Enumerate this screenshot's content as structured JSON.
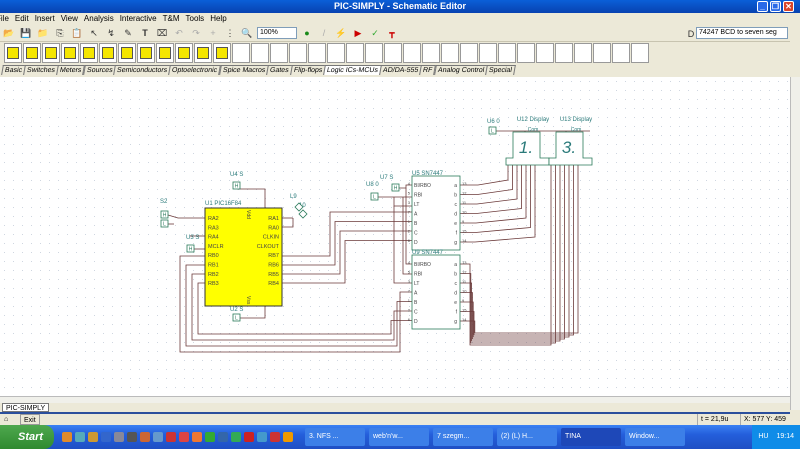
{
  "window": {
    "title": "PIC-SIMPLY - Schematic Editor"
  },
  "menu": [
    "File",
    "Edit",
    "Insert",
    "View",
    "Analysis",
    "Interactive",
    "T&M",
    "Tools",
    "Help"
  ],
  "toolbar": {
    "zoom": "100%",
    "component": "74247  BCD to seven seg"
  },
  "tabs": [
    "Basic",
    "Switches",
    "Meters",
    "Sources",
    "Semiconductors",
    "Optoelectronic",
    "Spice Macros",
    "Gates",
    "Flip-flops",
    "Logic ICs-MCUs",
    "AD/DA-555",
    "RF",
    "Analog Control",
    "Special"
  ],
  "active_tab": "Logic ICs-MCUs",
  "schematic": {
    "pic": {
      "label": "U1 PIC16F84",
      "left_pins": [
        "RA2",
        "RA3",
        "RA4",
        "MCLR",
        "RB0",
        "RB1",
        "RB2",
        "RB3"
      ],
      "right_pins": [
        "RA1",
        "RA0",
        "CLKIN",
        "CLKOUT",
        "RB7",
        "RB6",
        "RB5",
        "RB4"
      ],
      "vdd": "Vdd",
      "vss": "Vss"
    },
    "labels": {
      "u4": "U4 S",
      "s2": "S2",
      "u3": "U3 S",
      "l9": "L9",
      "l9_num": "10",
      "u2": "U2 S",
      "u7": "U7 S",
      "u8": "U8 0",
      "u6": "U6 0",
      "u12": "U12 Display",
      "u13": "U13 Display",
      "com": "Com",
      "digit1": "1.",
      "digit2": "3."
    },
    "decoder1": {
      "label": "U5 SN7447"
    },
    "decoder2": {
      "label": "U9 SN7447"
    },
    "decoder_inputs": [
      "BI/RBO",
      "RBI",
      "LT",
      "A",
      "B",
      "C",
      "D"
    ],
    "decoder_input_nums": [
      "4",
      "5",
      "3",
      "7",
      "1",
      "2",
      "6"
    ],
    "decoder_outputs": [
      "a",
      "b",
      "c",
      "d",
      "e",
      "f",
      "g"
    ],
    "decoder_output_nums": [
      "13",
      "12",
      "11",
      "10",
      "9",
      "15",
      "14"
    ],
    "H": "H",
    "L": "L"
  },
  "document_tab": "PIC-SIMPLY",
  "status": {
    "exit": "Exit",
    "time": "t = 21,9u",
    "coords": "X: 577  Y: 459"
  },
  "taskbar": {
    "start": "Start",
    "tasks": [
      "3. NFS ...",
      "web'n'w...",
      "7 szegm...",
      "(2) (L) H...",
      "TINA",
      "Window..."
    ],
    "lang": "HU",
    "clock": "19:14"
  }
}
